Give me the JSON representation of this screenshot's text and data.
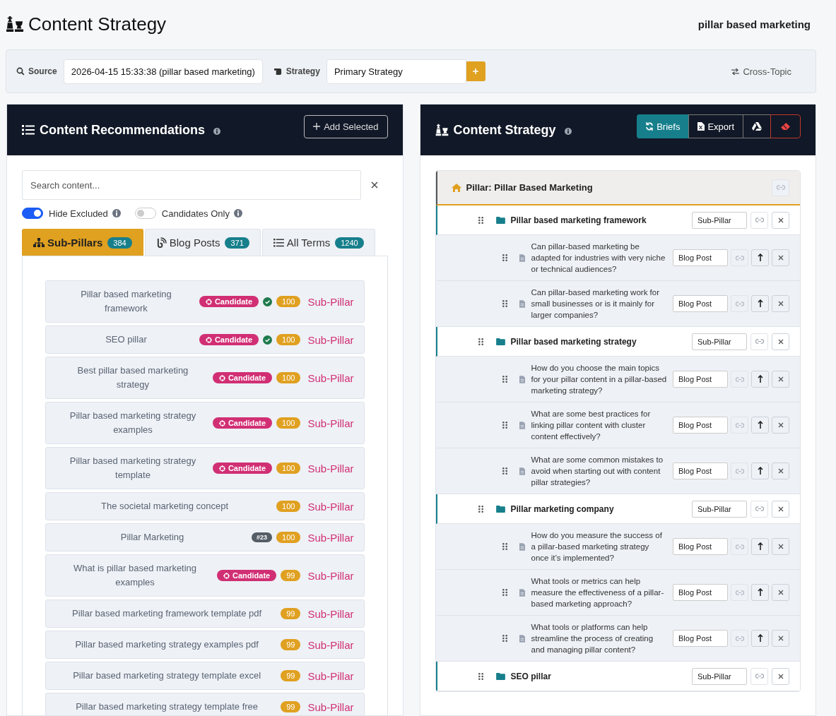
{
  "header": {
    "title": "Content Strategy",
    "keyword": "pillar based marketing"
  },
  "toolbar": {
    "source_label": "Source",
    "source_value": "2026-04-15 15:33:38 (pillar based marketing)",
    "strategy_label": "Strategy",
    "strategy_value": "Primary Strategy",
    "cross_topic": "Cross-Topic"
  },
  "recommendations": {
    "title": "Content Recommendations",
    "add_selected": "Add Selected",
    "search": {
      "placeholder": "Search content..."
    },
    "toggles": [
      {
        "label": "Hide Excluded",
        "on": true
      },
      {
        "label": "Candidates Only",
        "on": false
      }
    ],
    "tabs": [
      {
        "kind": "sitemap",
        "label": "Sub-Pillars",
        "count": "384",
        "selected": true
      },
      {
        "kind": "blog",
        "label": "Blog Posts",
        "count": "371",
        "selected": false
      },
      {
        "kind": "list",
        "label": "All Terms",
        "count": "1240",
        "selected": false
      }
    ],
    "items": [
      {
        "title": "Pillar based marketing framework",
        "candidate": "Candidate",
        "approved": true,
        "score": "100",
        "type": "Sub-Pillar"
      },
      {
        "title": "SEO pillar",
        "candidate": "Candidate",
        "approved": true,
        "score": "100",
        "type": "Sub-Pillar"
      },
      {
        "title": "Best pillar based marketing strategy",
        "candidate": "Candidate",
        "approved": false,
        "score": "100",
        "type": "Sub-Pillar"
      },
      {
        "title": "Pillar based marketing strategy examples",
        "candidate": "Candidate",
        "approved": false,
        "score": "100",
        "type": "Sub-Pillar"
      },
      {
        "title": "Pillar based marketing strategy template",
        "candidate": "Candidate",
        "approved": false,
        "score": "100",
        "type": "Sub-Pillar"
      },
      {
        "title": "The societal marketing concept",
        "approved": false,
        "score": "100",
        "type": "Sub-Pillar"
      },
      {
        "title": "Pillar Marketing",
        "tag": "#23",
        "approved": false,
        "score": "100",
        "type": "Sub-Pillar"
      },
      {
        "title": "What is pillar based marketing examples",
        "candidate": "Candidate",
        "approved": false,
        "score": "99",
        "type": "Sub-Pillar"
      },
      {
        "title": "Pillar based marketing framework template pdf",
        "approved": false,
        "score": "99",
        "type": "Sub-Pillar"
      },
      {
        "title": "Pillar based marketing strategy examples pdf",
        "approved": false,
        "score": "99",
        "type": "Sub-Pillar"
      },
      {
        "title": "Pillar based marketing strategy template excel",
        "approved": false,
        "score": "99",
        "type": "Sub-Pillar"
      },
      {
        "title": "Pillar based marketing strategy template free",
        "approved": false,
        "score": "99",
        "type": "Sub-Pillar"
      }
    ]
  },
  "strategy": {
    "title": "Content Strategy",
    "buttons": [
      {
        "kind": "briefs",
        "label": "Briefs"
      },
      {
        "kind": "export",
        "label": "Export"
      },
      {
        "kind": "drive"
      },
      {
        "kind": "erase"
      }
    ],
    "pillar": {
      "title": "Pillar: Pillar Based Marketing",
      "children": [
        {
          "title": "Pillar based marketing framework",
          "type": "Sub-Pillar",
          "children": [
            {
              "title": "Can pillar-based marketing be adapted for industries with very niche or technical audiences?",
              "type": "Blog Post"
            },
            {
              "title": "Can pillar-based marketing work for small businesses or is it mainly for larger companies?",
              "type": "Blog Post"
            }
          ]
        },
        {
          "title": "Pillar based marketing strategy",
          "type": "Sub-Pillar",
          "children": [
            {
              "title": "How do you choose the main topics for your pillar content in a pillar-based marketing strategy?",
              "type": "Blog Post"
            },
            {
              "title": "What are some best practices for linking pillar content with cluster content effectively?",
              "type": "Blog Post"
            },
            {
              "title": "What are some common mistakes to avoid when starting out with content pillar strategies?",
              "type": "Blog Post"
            }
          ]
        },
        {
          "title": "Pillar marketing company",
          "type": "Sub-Pillar",
          "children": [
            {
              "title": "How do you measure the success of a pillar-based marketing strategy once it’s implemented?",
              "type": "Blog Post"
            },
            {
              "title": "What tools or metrics can help measure the effectiveness of a pillar-based marketing approach?",
              "type": "Blog Post"
            },
            {
              "title": "What tools or platforms can help streamline the process of creating and managing pillar content?",
              "type": "Blog Post"
            }
          ]
        },
        {
          "title": "SEO pillar",
          "type": "Sub-Pillar"
        }
      ]
    }
  }
}
